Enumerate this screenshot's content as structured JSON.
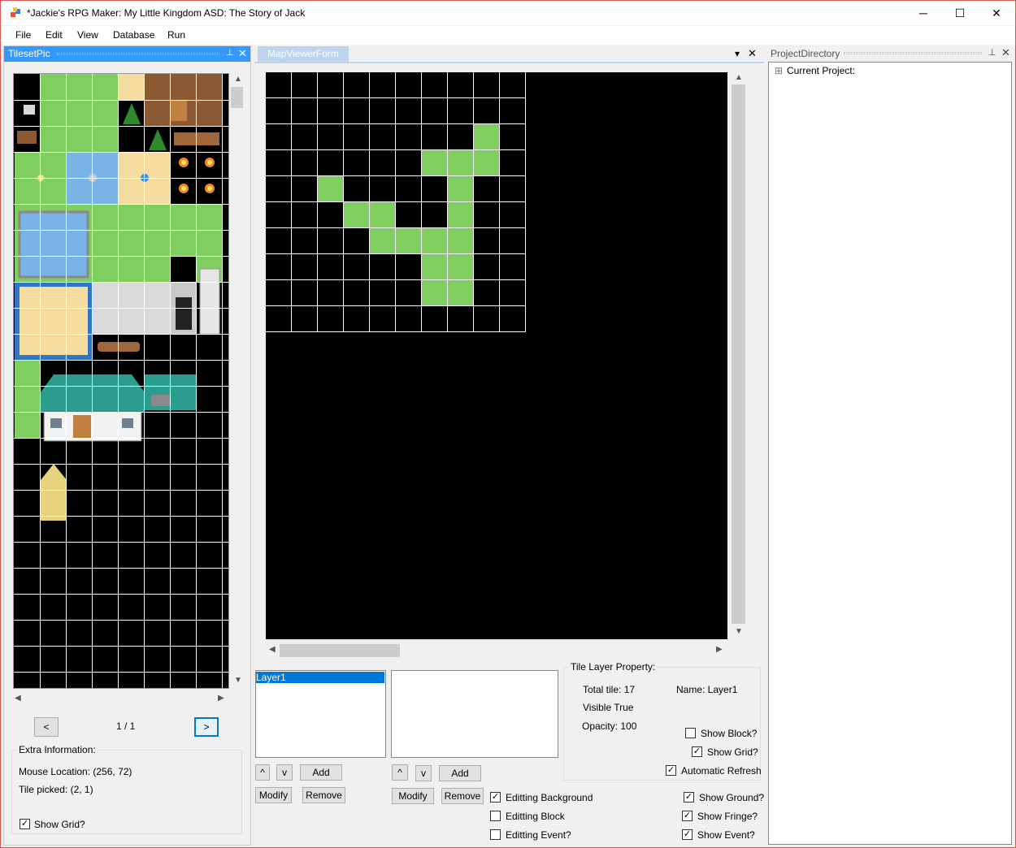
{
  "window": {
    "title": "*Jackie's RPG Maker: My Little Kingdom ASD: The Story of Jack",
    "minimize": "─",
    "maximize": "☐",
    "close": "✕"
  },
  "menu": {
    "items": [
      "File",
      "Edit",
      "View",
      "Database",
      "Run"
    ]
  },
  "tileset_panel": {
    "title": "TilesetPic",
    "pin": "⊥",
    "close": "✕",
    "prev": "<",
    "next": ">",
    "page": "1 / 1",
    "extra_title": "Extra Information:",
    "mouse_location": "Mouse Location: (256, 72)",
    "tile_picked": "Tile picked: (2, 1)",
    "show_grid": "Show Grid?",
    "show_grid_checked": true
  },
  "map_viewer": {
    "tab": "MapViewerForm",
    "dropdown": "▾",
    "close": "✕",
    "grid_cols": 10,
    "grid_rows": 10,
    "grass_cells": [
      [
        8,
        2
      ],
      [
        6,
        3
      ],
      [
        7,
        3
      ],
      [
        8,
        3
      ],
      [
        2,
        4
      ],
      [
        7,
        4
      ],
      [
        3,
        5
      ],
      [
        4,
        5
      ],
      [
        7,
        5
      ],
      [
        4,
        6
      ],
      [
        5,
        6
      ],
      [
        6,
        6
      ],
      [
        7,
        6
      ],
      [
        6,
        7
      ],
      [
        7,
        7
      ],
      [
        6,
        8
      ],
      [
        7,
        8
      ]
    ]
  },
  "layers": {
    "items": [
      "Layer1"
    ],
    "up": "^",
    "down": "v",
    "add": "Add",
    "modify": "Modify",
    "remove": "Remove"
  },
  "sublayers": {
    "up": "^",
    "down": "v",
    "add": "Add",
    "modify": "Modify",
    "remove": "Remove"
  },
  "tile_layer_property": {
    "title": "Tile Layer Property:",
    "total_tile": "Total tile: 17",
    "name": "Name: Layer1",
    "visible": "Visible True",
    "opacity": "Opacity: 100",
    "show_block": "Show Block?",
    "show_grid": "Show Grid?",
    "auto_refresh": "Automatic Refresh"
  },
  "options": {
    "editing_background": "Editting Background",
    "editing_block": "Editting Block",
    "editing_event": "Editting Event?",
    "show_ground": "Show Ground?",
    "show_fringe": "Show Fringe?",
    "show_event": "Show Event?"
  },
  "project_panel": {
    "title": "ProjectDirectory",
    "pin": "⊥",
    "close": "✕",
    "tree_root": "Current Project:",
    "expander": "⊞"
  },
  "colors": {
    "accent": "#3399ff",
    "grass": "#7fce5f",
    "tab_inactive": "#bdd3ee"
  }
}
